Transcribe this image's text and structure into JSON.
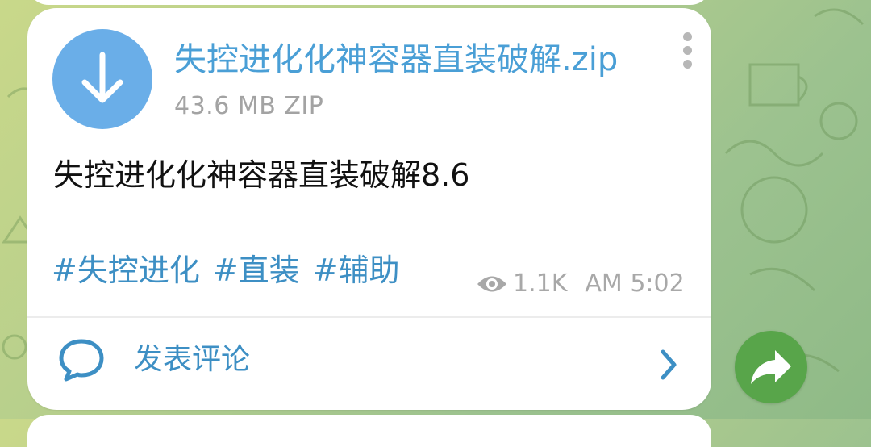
{
  "colors": {
    "accent": "#4a9fd6",
    "link": "#3d8fc4",
    "download_circle": "#6aaee8",
    "forward_button": "#58a54a",
    "meta_text": "#a8a8a8"
  },
  "file": {
    "name": "失控进化化神容器直装破解.zip",
    "size": "43.6 MB",
    "type": "ZIP",
    "icon": "download-arrow-icon"
  },
  "message": {
    "text": "失控进化化神容器直装破解8.6",
    "tags": [
      "#失控进化",
      "#直装",
      "#辅助"
    ],
    "views": "1.1K",
    "time": "AM 5:02"
  },
  "comments": {
    "label": "发表评论",
    "icon": "comment-bubble-icon"
  },
  "actions": {
    "menu_icon": "more-vertical-icon",
    "forward_icon": "forward-share-icon"
  }
}
